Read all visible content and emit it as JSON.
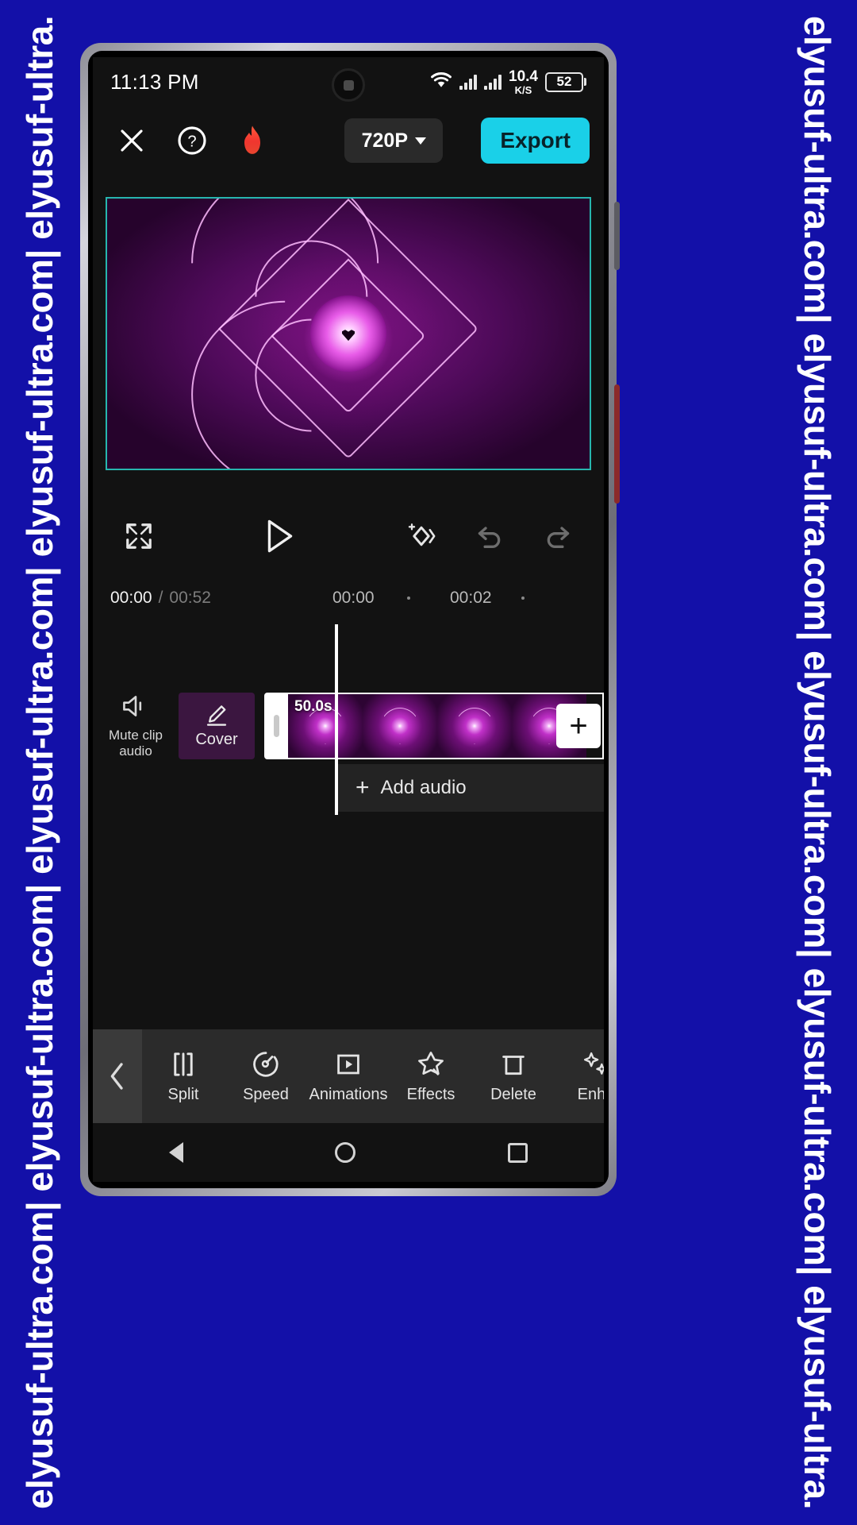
{
  "watermark": {
    "text": "elyusuf-ultra.com| elyusuf-ultra.com| elyusuf-ultra.com| elyusuf-ultra.com| elyusuf-ultra."
  },
  "status_bar": {
    "time": "11:13 PM",
    "net_speed_value": "10.4",
    "net_speed_unit": "K/S",
    "battery_level": "52",
    "icons": [
      "wifi-icon",
      "signal-icon",
      "signal-icon",
      "battery-icon"
    ]
  },
  "toolbar": {
    "close_icon": "close-icon",
    "help_icon": "help-icon",
    "flame_icon": "flame-icon",
    "resolution_label": "720P",
    "export_label": "Export",
    "accent_color": "#1ad0e8"
  },
  "preview": {
    "border_color": "#27b6ae",
    "description": "heart-video-frame"
  },
  "controls": {
    "fullscreen_icon": "fullscreen-icon",
    "play_icon": "play-icon",
    "keyframe_icon": "add-keyframe-icon",
    "undo_icon": "undo-icon",
    "redo_icon": "redo-icon"
  },
  "timeline": {
    "current_time": "00:00",
    "separator": "/",
    "total_time": "00:52",
    "ruler_ticks": [
      "00:00",
      "00:02"
    ],
    "mute_clip_label_line1": "Mute clip",
    "mute_clip_label_line2": "audio",
    "cover_label": "Cover",
    "clip_duration": "50.0s",
    "add_clip_label": "+",
    "add_audio_label": "Add audio",
    "add_audio_plus": "+"
  },
  "bottom_toolbar": {
    "back_icon": "chevron-left-icon",
    "tools": [
      {
        "label": "Split",
        "icon": "split-icon"
      },
      {
        "label": "Speed",
        "icon": "speed-icon"
      },
      {
        "label": "Animations",
        "icon": "animations-icon"
      },
      {
        "label": "Effects",
        "icon": "effects-icon"
      },
      {
        "label": "Delete",
        "icon": "delete-icon"
      },
      {
        "label": "Enha",
        "icon": "enhance-icon"
      }
    ]
  },
  "nav_bar": {
    "back_icon": "nav-back-icon",
    "home_icon": "nav-home-icon",
    "recents_icon": "nav-recents-icon"
  }
}
